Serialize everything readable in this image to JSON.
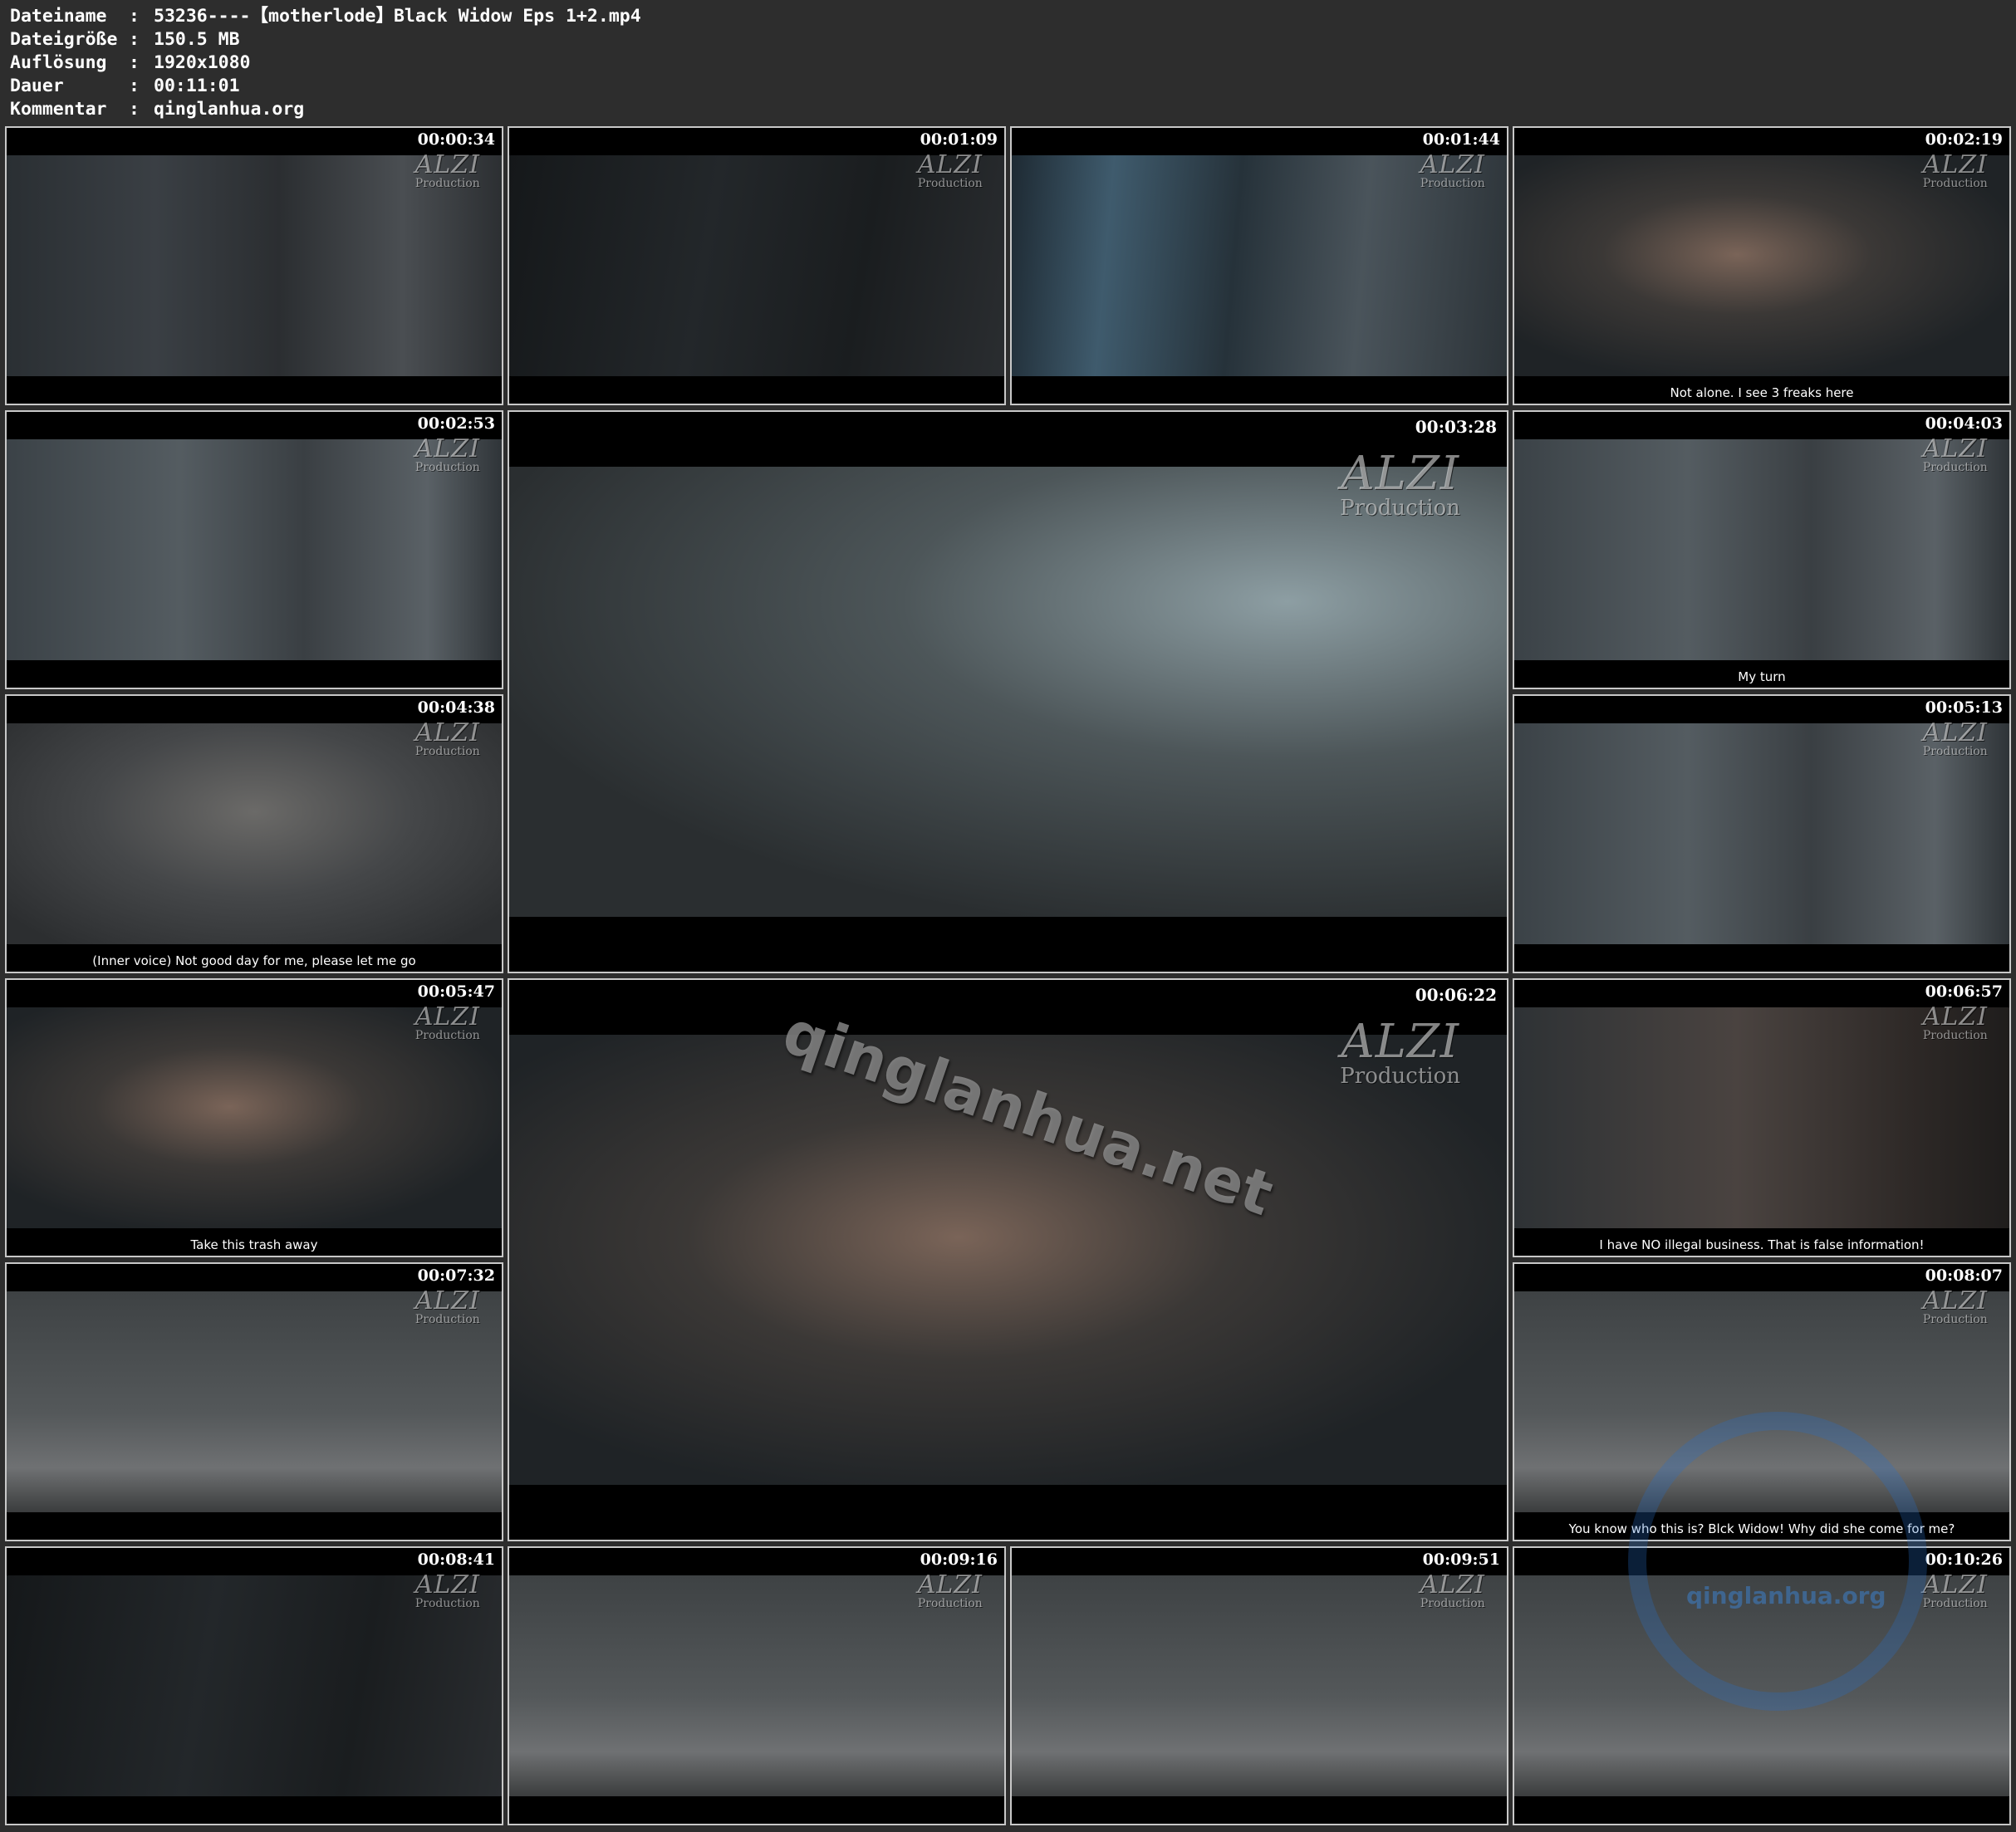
{
  "header": [
    {
      "label": "Dateiname",
      "sep": ":",
      "value": "53236----【motherlode】Black Widow Eps 1+2.mp4"
    },
    {
      "label": "Dateigröße",
      "sep": ":",
      "value": "150.5 MB"
    },
    {
      "label": "Auflösung",
      "sep": ":",
      "value": "1920x1080"
    },
    {
      "label": "Dauer",
      "sep": ":",
      "value": "00:11:01"
    },
    {
      "label": "Kommentar",
      "sep": ":",
      "value": "qinglanhua.org"
    }
  ],
  "logo": {
    "line1": "ALZI",
    "line2": "Production"
  },
  "watermark": "qinglanhua.net",
  "seal_text": "qinglanhua.org",
  "thumbnails": [
    {
      "time": "00:00:34",
      "subtitle": "",
      "scene": "dark-room"
    },
    {
      "time": "00:01:09",
      "subtitle": "",
      "scene": "very-dark"
    },
    {
      "time": "00:01:44",
      "subtitle": "",
      "scene": "blue-dark"
    },
    {
      "time": "00:02:19",
      "subtitle": "Not alone. I see 3 freaks here",
      "scene": "portrait"
    },
    {
      "time": "00:02:53",
      "subtitle": "",
      "scene": "fight"
    },
    {
      "time": "00:03:28",
      "subtitle": "",
      "scene": "smoky"
    },
    {
      "time": "00:04:03",
      "subtitle": "My turn",
      "scene": "fight"
    },
    {
      "time": "00:04:38",
      "subtitle": "(Inner voice) Not good day for me, please let me go",
      "scene": "floor"
    },
    {
      "time": "00:05:13",
      "subtitle": "",
      "scene": "fight"
    },
    {
      "time": "00:05:47",
      "subtitle": "Take this trash away",
      "scene": "portrait"
    },
    {
      "time": "00:06:22",
      "subtitle": "",
      "scene": "portrait"
    },
    {
      "time": "00:06:57",
      "subtitle": "I have NO illegal business. That is false information!",
      "scene": "warm-dark"
    },
    {
      "time": "00:07:32",
      "subtitle": "",
      "scene": "bedroom"
    },
    {
      "time": "00:08:07",
      "subtitle": "You know who this is? Blck Widow! Why did she come for me?",
      "scene": "bedroom"
    },
    {
      "time": "00:08:41",
      "subtitle": "",
      "scene": "very-dark"
    },
    {
      "time": "00:09:16",
      "subtitle": "",
      "scene": "bedroom"
    },
    {
      "time": "00:09:51",
      "subtitle": "",
      "scene": "bedroom"
    },
    {
      "time": "00:10:26",
      "subtitle": "",
      "scene": "bedroom"
    }
  ]
}
